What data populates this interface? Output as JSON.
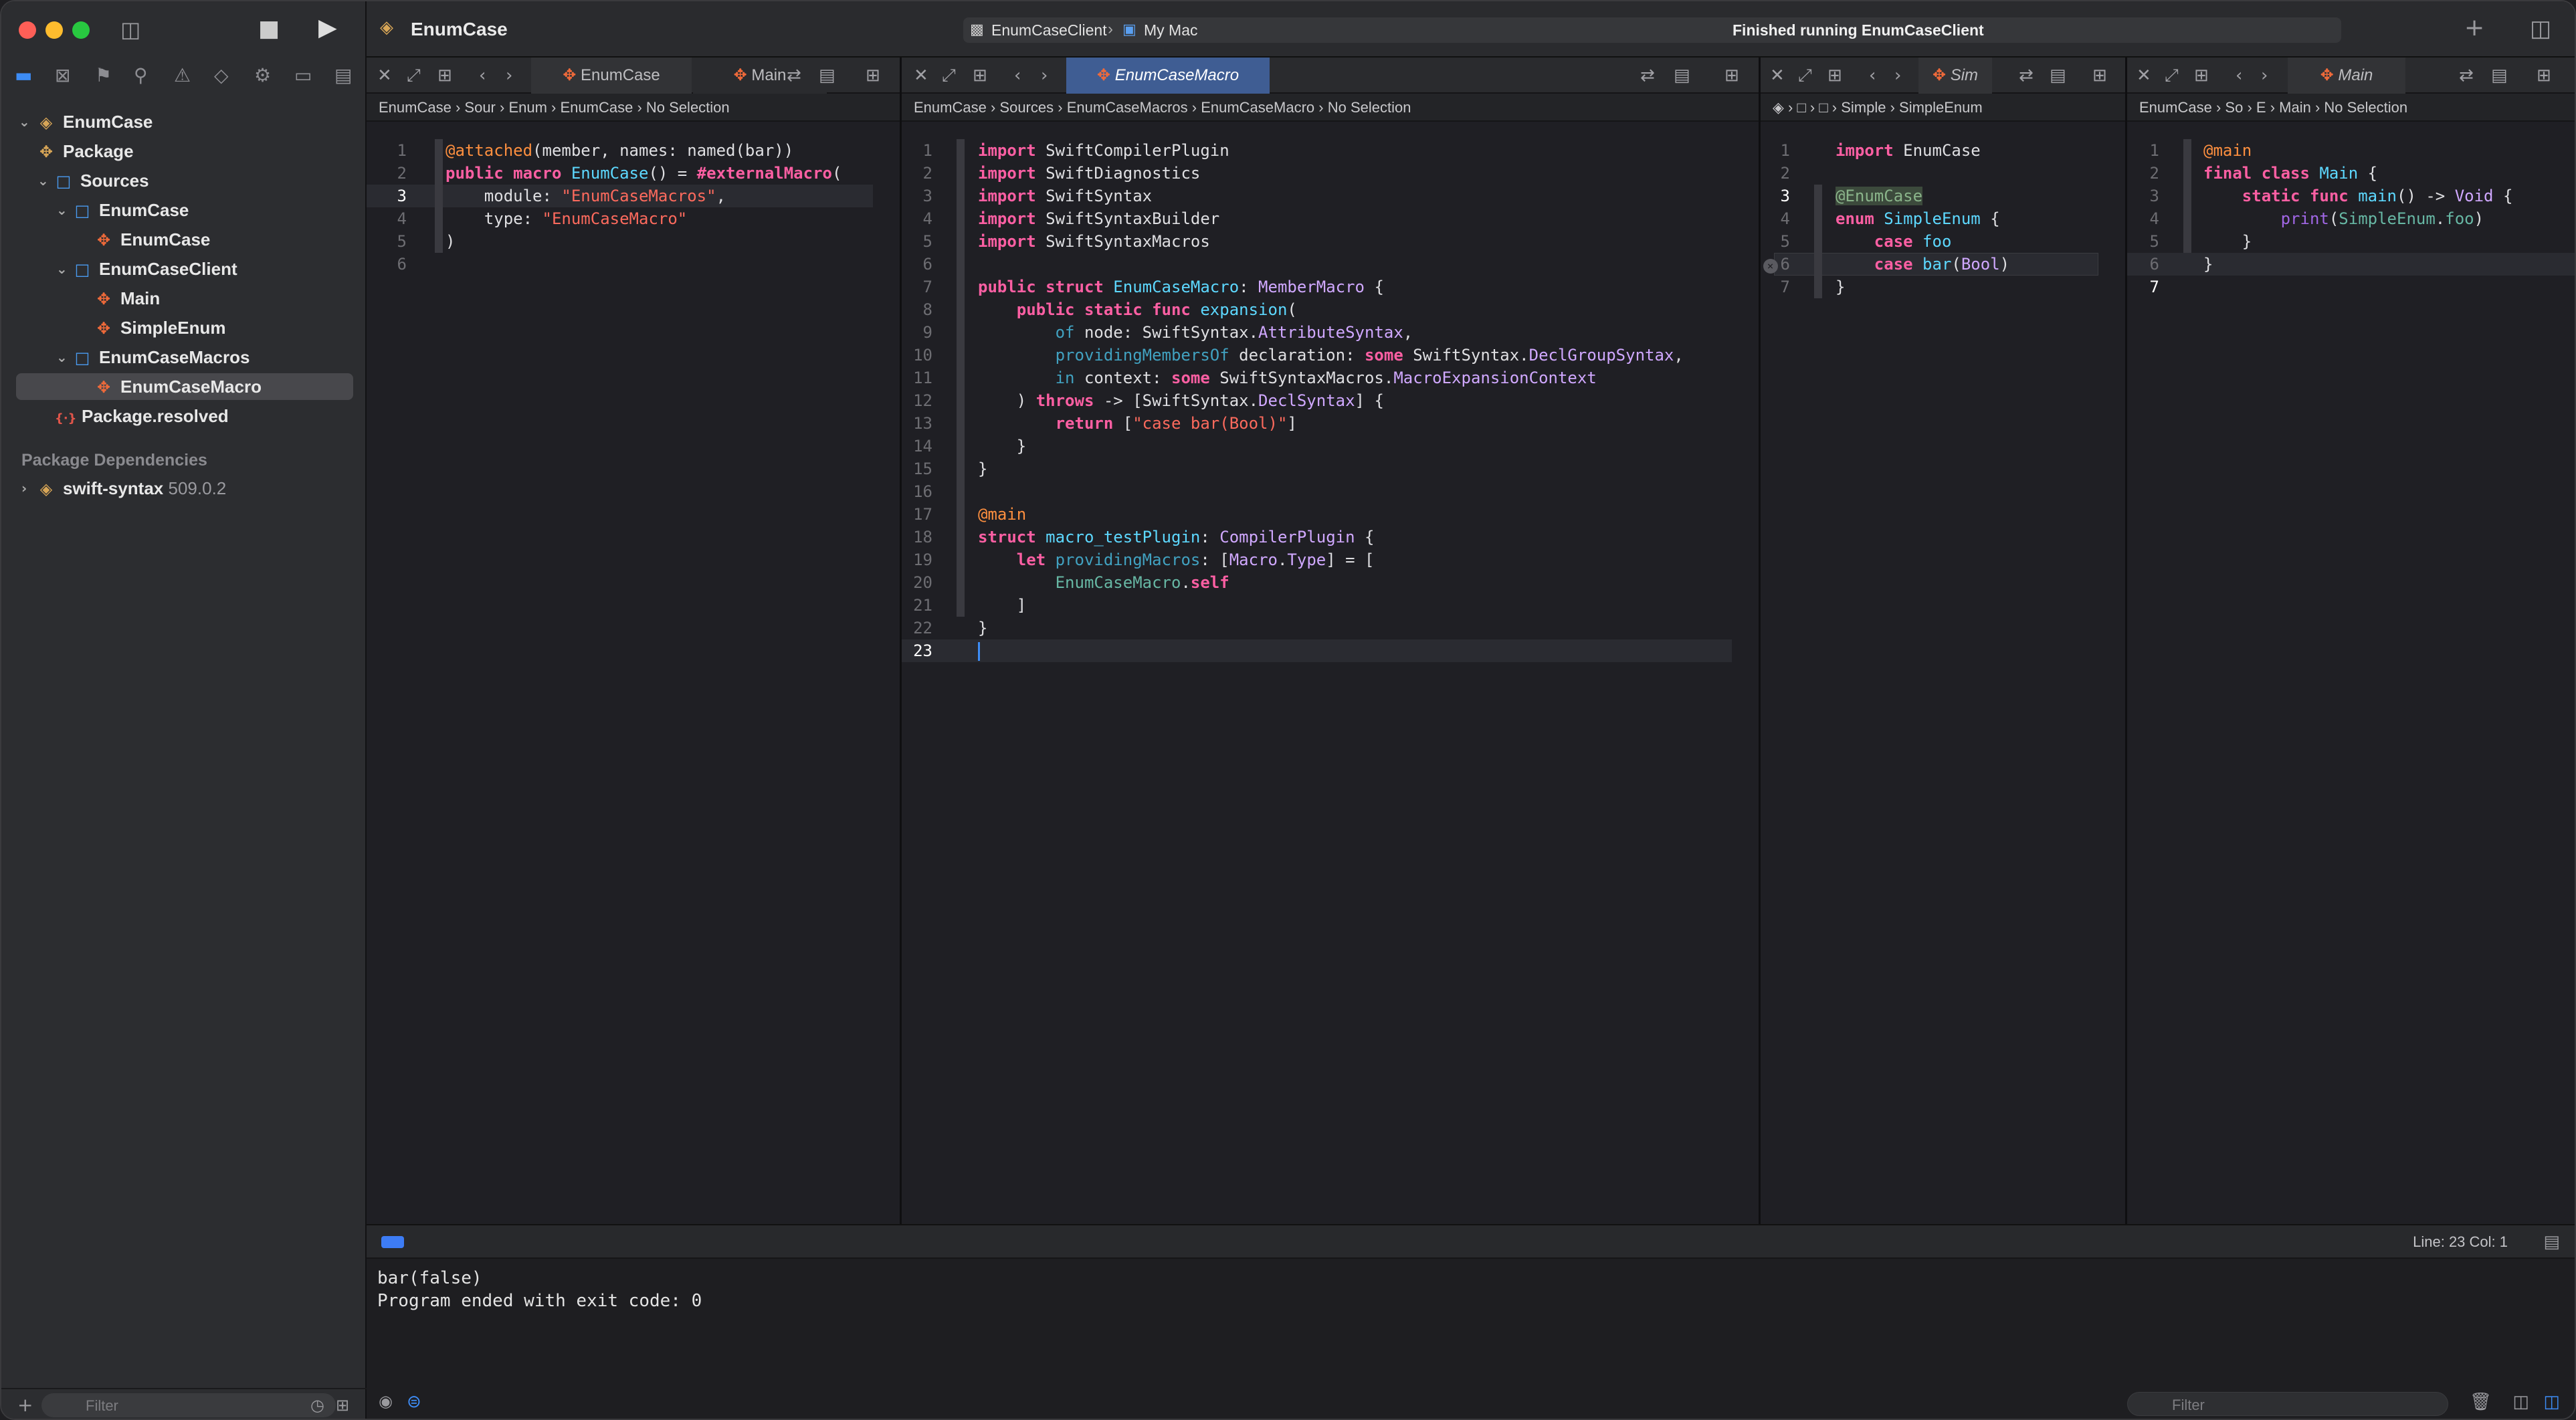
{
  "window": {
    "title": "EnumCase",
    "scheme": "EnumCaseClient",
    "destination": "My Mac",
    "status": "Finished running EnumCaseClient"
  },
  "sidebar": {
    "items": [
      {
        "label": "EnumCase",
        "kind": "project-icon"
      },
      {
        "label": "Package",
        "kind": "swift-icon"
      },
      {
        "label": "Sources",
        "kind": "folder-icon"
      },
      {
        "label": "EnumCase",
        "kind": "folder-icon"
      },
      {
        "label": "EnumCase",
        "kind": "swift-icon"
      },
      {
        "label": "EnumCaseClient",
        "kind": "folder-icon"
      },
      {
        "label": "Main",
        "kind": "swift-icon"
      },
      {
        "label": "SimpleEnum",
        "kind": "swift-icon"
      },
      {
        "label": "EnumCaseMacros",
        "kind": "folder-icon"
      },
      {
        "label": "EnumCaseMacro",
        "kind": "swift-icon"
      },
      {
        "label": "Package.resolved",
        "kind": "resolved-icon"
      }
    ],
    "section": "Package Dependencies",
    "dependency": {
      "name": "swift-syntax",
      "version": "509.0.2"
    },
    "filter_placeholder": "Filter"
  },
  "panes": [
    {
      "tabs": [
        "EnumCase",
        "Main"
      ],
      "jump": [
        "EnumCase",
        "Sour",
        "Enum",
        "EnumCase",
        "No Selection"
      ]
    },
    {
      "tabs": [
        "EnumCaseMacro"
      ],
      "jump": [
        "EnumCase",
        "Sources",
        "EnumCaseMacros",
        "EnumCaseMacro",
        "No Selection"
      ]
    },
    {
      "tabs": [
        "Sim"
      ],
      "jump": [
        "",
        "",
        "",
        "Simple",
        "SimpleEnum"
      ]
    },
    {
      "tabs": [
        "Main"
      ],
      "jump": [
        "EnumCase",
        "So",
        "E",
        "Main",
        "No Selection"
      ]
    }
  ],
  "debug": {
    "output_line1": "bar(false)",
    "output_line2": "Program ended with exit code: 0",
    "cursor": "Line: 23  Col: 1",
    "filter_placeholder": "Filter"
  }
}
